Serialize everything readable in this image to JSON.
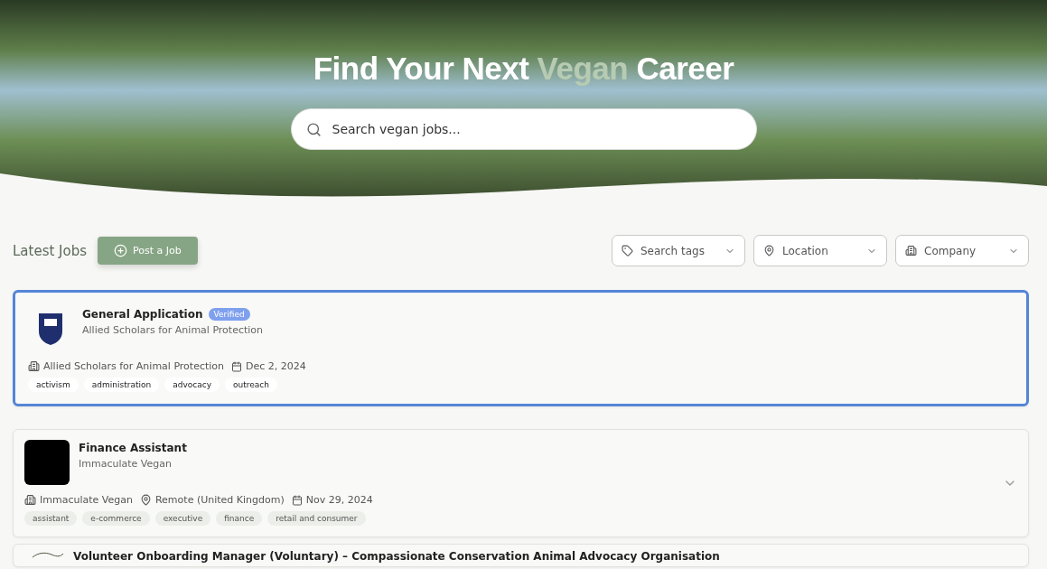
{
  "hero": {
    "title_start": "Find Your Next ",
    "title_highlight": "Vegan",
    "title_end": " Career",
    "search": {
      "placeholder": "Search vegan jobs..."
    }
  },
  "toolbar": {
    "heading": "Latest Jobs",
    "post_button": "Post a Job",
    "filters": [
      {
        "kind": "tag",
        "placeholder": "Search tags"
      },
      {
        "kind": "location",
        "placeholder": "Location"
      },
      {
        "kind": "company",
        "placeholder": "Company"
      }
    ]
  },
  "jobs": [
    {
      "title": "General Application",
      "verified": true,
      "verified_label": "Verified",
      "company": "Allied Scholars for Animal Protection",
      "selected": true,
      "collapsible": false,
      "kind": "crest",
      "meta": [
        {
          "kind": "company",
          "text": "Allied Scholars for Animal Protection"
        },
        {
          "kind": "date",
          "text": "Dec 2, 2024"
        }
      ],
      "tags": [
        "activism",
        "administration",
        "advocacy",
        "outreach"
      ]
    },
    {
      "title": "Finance Assistant",
      "verified": false,
      "company": "Immaculate Vegan",
      "selected": false,
      "collapsible": true,
      "kind": "dark",
      "meta": [
        {
          "kind": "company",
          "text": "Immaculate Vegan"
        },
        {
          "kind": "location",
          "text": "Remote (United Kingdom)"
        },
        {
          "kind": "date",
          "text": "Nov 29, 2024"
        }
      ],
      "tags": [
        "assistant",
        "e-commerce",
        "executive",
        "finance",
        "retail and consumer"
      ]
    },
    {
      "title": "Volunteer Onboarding Manager (Voluntary) – Compassionate Conservation Animal Advocacy Organisation",
      "verified": false,
      "selected": false,
      "collapsible": false,
      "kind": "sketch"
    }
  ]
}
